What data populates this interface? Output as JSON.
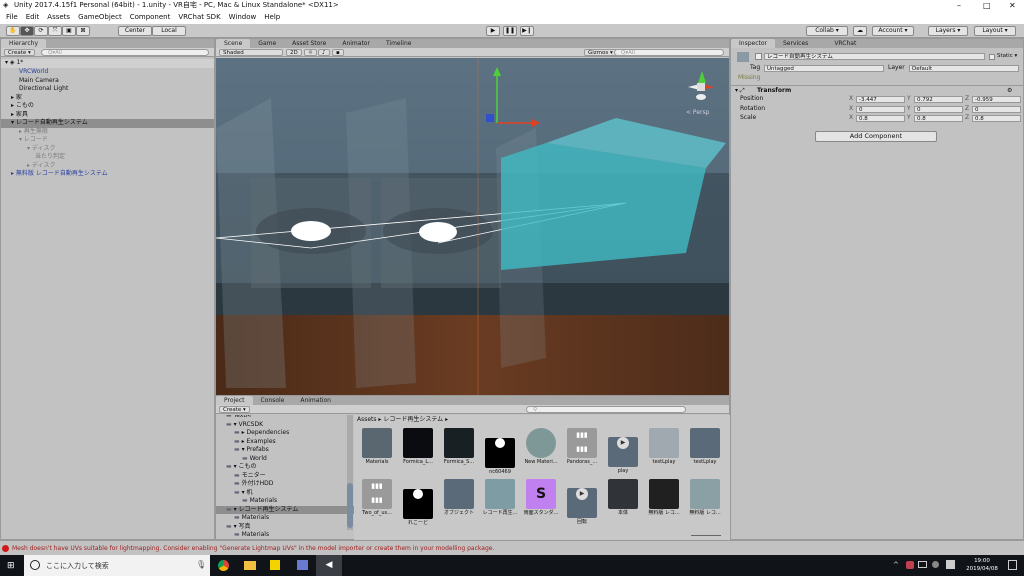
{
  "window": {
    "title": "Unity 2017.4.15f1 Personal (64bit) - 1.unity - VR自宅 - PC, Mac & Linux Standalone* <DX11>"
  },
  "menu": [
    "File",
    "Edit",
    "Assets",
    "GameObject",
    "Component",
    "VRChat SDK",
    "Window",
    "Help"
  ],
  "toolbar": {
    "center": "Center",
    "local": "Local",
    "collab": "Collab ▾",
    "account": "Account ▾",
    "layers": "Layers ▾",
    "layout": "Layout ▾"
  },
  "hierarchy": {
    "tab": "Hierarchy",
    "create": "Create ▾",
    "search_placeholder": "Q▾All",
    "scene": "1*",
    "items": [
      {
        "label": "VRCWorld",
        "indent": 1,
        "style": "blue"
      },
      {
        "label": "Main Camera",
        "indent": 1
      },
      {
        "label": "Directional Light",
        "indent": 1
      },
      {
        "label": "▸ 家",
        "indent": 0
      },
      {
        "label": "▸ こもの",
        "indent": 0
      },
      {
        "label": "▸ 家具",
        "indent": 0
      },
      {
        "label": "▾ レコード自動再生システム",
        "indent": 0,
        "style": "sel"
      },
      {
        "label": "▸ 再生無限",
        "indent": 1,
        "style": "gray"
      },
      {
        "label": "▾ レコード",
        "indent": 1,
        "style": "gray"
      },
      {
        "label": "▾ ディスク",
        "indent": 2,
        "style": "gray"
      },
      {
        "label": "当たり判定",
        "indent": 3,
        "style": "gray"
      },
      {
        "label": "▸ ディスク",
        "indent": 2,
        "style": "gray"
      },
      {
        "label": "▸ 無料版 レコード自動再生システム",
        "indent": 0,
        "style": "blue"
      }
    ]
  },
  "scene": {
    "tabs": [
      "Scene",
      "Game",
      "Asset Store",
      "Animator",
      "Timeline"
    ],
    "shading": "Shaded",
    "mode_2d": "2D",
    "gizmos": "Gizmos ▾",
    "search_placeholder": "Q▾All",
    "persp_label": "< Persp"
  },
  "inspector": {
    "tabs": [
      "Inspector",
      "Services",
      "VRChat"
    ],
    "object_name": "レコード自動再生システム",
    "static": "Static ▾",
    "tag_label": "Tag",
    "tag": "Untagged",
    "layer_label": "Layer",
    "layer": "Default",
    "missing": "Missing",
    "transform": {
      "title": "Transform",
      "rows": [
        {
          "label": "Position",
          "x": "-3.447",
          "y": "0.792",
          "z": "-0.959"
        },
        {
          "label": "Rotation",
          "x": "0",
          "y": "0",
          "z": "0"
        },
        {
          "label": "Scale",
          "x": "0.8",
          "y": "0.8",
          "z": "0.8"
        }
      ]
    },
    "add_component": "Add Component"
  },
  "project": {
    "tabs": [
      "Project",
      "Console",
      "Animation"
    ],
    "create": "Create ▾",
    "tree": [
      {
        "label": "TextM",
        "indent": 1
      },
      {
        "label": "▾ VRCSDK",
        "indent": 1
      },
      {
        "label": "▸ Dependencies",
        "indent": 2
      },
      {
        "label": "▸ Examples",
        "indent": 2
      },
      {
        "label": "▾ Prefabs",
        "indent": 2
      },
      {
        "label": "World",
        "indent": 3
      },
      {
        "label": "▾ こもの",
        "indent": 1
      },
      {
        "label": "モニター",
        "indent": 2
      },
      {
        "label": "外付けHDD",
        "indent": 2
      },
      {
        "label": "▾ 机",
        "indent": 2
      },
      {
        "label": "Materials",
        "indent": 3
      },
      {
        "label": "▾ レコード再生システム",
        "indent": 1,
        "style": "sel"
      },
      {
        "label": "Materials",
        "indent": 2
      },
      {
        "label": "▾ 写真",
        "indent": 1
      },
      {
        "label": "Materials",
        "indent": 2
      }
    ],
    "breadcrumb": "Assets ▸ レコード再生システム ▸",
    "assets": [
      {
        "name": "Materials",
        "icon": "folder-icon",
        "color": "#5a6670"
      },
      {
        "name": "Formica_L...",
        "icon": "texture-icon",
        "color": "#0a0c10"
      },
      {
        "name": "Formica_S...",
        "icon": "texture-icon",
        "color": "#182024"
      },
      {
        "name": "nc60469",
        "icon": "record-icon",
        "color": "#000000"
      },
      {
        "name": "New Materi...",
        "icon": "material-sphere-icon",
        "color": "#7e9898"
      },
      {
        "name": "Pandoras_...",
        "icon": "audio-icon",
        "color": "#f2b81c"
      },
      {
        "name": "play",
        "icon": "animation-clip-icon",
        "color": "#5a6a78"
      },
      {
        "name": "testLplay",
        "icon": "model-icon",
        "color": "#a0a8b0"
      },
      {
        "name": "testLplay",
        "icon": "animator-icon",
        "color": "#5a6a78"
      },
      {
        "name": "Two_of_us...",
        "icon": "audio-icon",
        "color": "#f2b81c"
      },
      {
        "name": "れこーど",
        "icon": "record-icon",
        "color": "#000000"
      },
      {
        "name": "オブジェクト",
        "icon": "animator-icon",
        "color": "#5a6a78"
      },
      {
        "name": "レコード再生...",
        "icon": "model-icon",
        "color": "#7e9ca4"
      },
      {
        "name": "両面スタンダ...",
        "icon": "shader-icon",
        "color": "#c080f0"
      },
      {
        "name": "回転",
        "icon": "animation-clip-icon",
        "color": "#5a6a78"
      },
      {
        "name": "本体",
        "icon": "model-icon",
        "color": "#303438"
      },
      {
        "name": "無料版 レコ...",
        "icon": "model-icon",
        "color": "#202020"
      },
      {
        "name": "無料版 レコ...",
        "icon": "model-icon",
        "color": "#8aa0a4"
      }
    ]
  },
  "status": {
    "message": "Mesh doesn't have UVs suitable for lightmapping. Consider enabling \"Generate Lightmap UVs\" in the model importer or create them in your modelling package."
  },
  "taskbar": {
    "search_placeholder": "ここに入力して検索",
    "time": "19:00",
    "date": "2019/04/08"
  }
}
